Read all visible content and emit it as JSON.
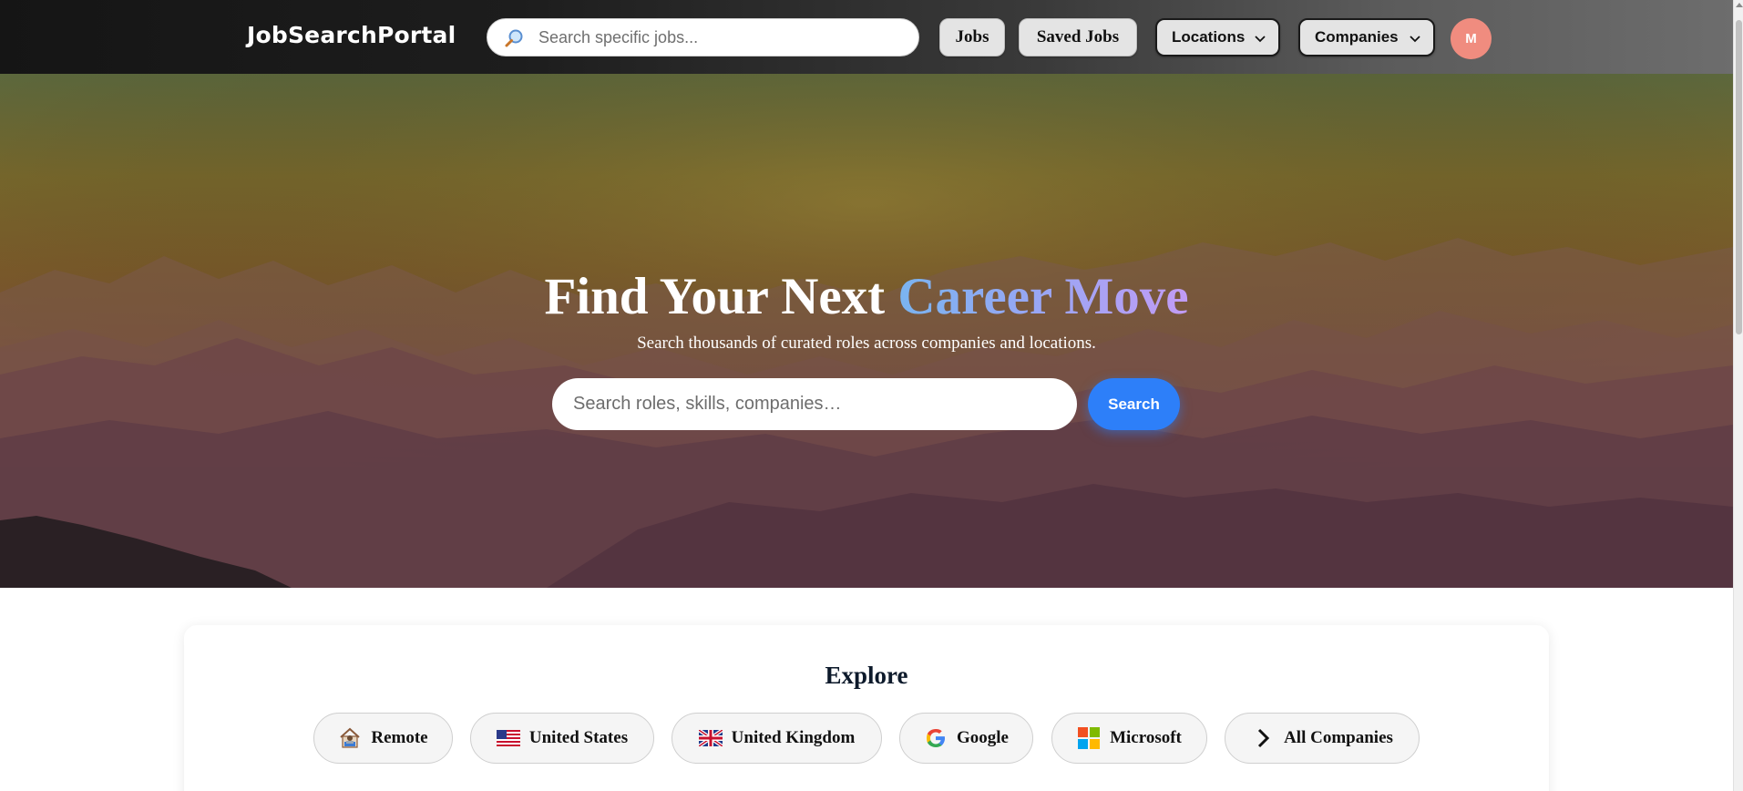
{
  "header": {
    "logo": "JobSearchPortal",
    "search_placeholder": "Search specific jobs...",
    "nav": {
      "jobs": "Jobs",
      "saved_jobs": "Saved Jobs",
      "locations": "Locations",
      "companies": "Companies"
    },
    "avatar_initial": "M"
  },
  "hero": {
    "title_plain": "Find Your Next",
    "title_accent": "Career Move",
    "subtitle": "Search thousands of curated roles across companies and locations.",
    "search_placeholder": "Search roles, skills, companies…",
    "search_button": "Search"
  },
  "explore": {
    "title": "Explore",
    "chips": [
      {
        "label": "Remote",
        "icon": "remote-worker-icon"
      },
      {
        "label": "United States",
        "icon": "us-flag-icon"
      },
      {
        "label": "United Kingdom",
        "icon": "uk-flag-icon"
      },
      {
        "label": "Google",
        "icon": "google-logo-icon"
      },
      {
        "label": "Microsoft",
        "icon": "microsoft-logo-icon"
      },
      {
        "label": "All Companies",
        "icon": "chevron-right-icon"
      }
    ]
  },
  "colors": {
    "accent_blue": "#2d7ff9",
    "avatar_bg": "#f08c7f",
    "header_dark": "#151515"
  }
}
